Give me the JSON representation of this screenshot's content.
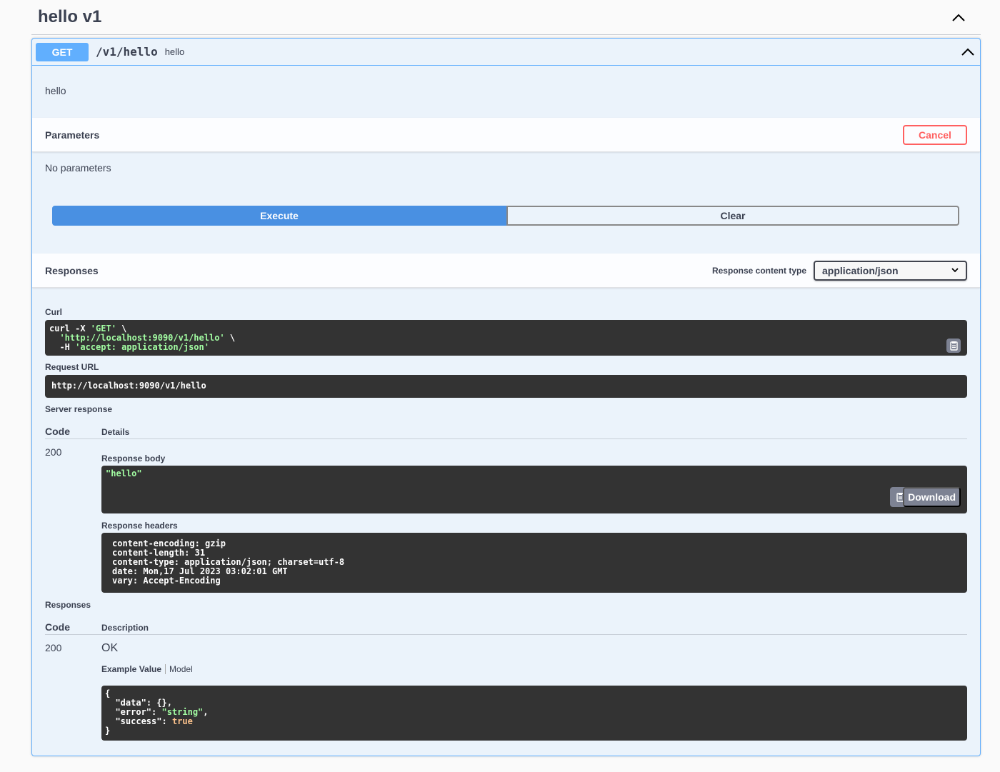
{
  "tag": {
    "title": "hello v1",
    "toggle_icon": "chevron-up-icon"
  },
  "operation": {
    "method": "GET",
    "path": "/v1/hello",
    "summary": "hello",
    "description": "hello",
    "collapse_icon": "chevron-up-icon"
  },
  "parameters": {
    "title": "Parameters",
    "cancel_label": "Cancel",
    "empty_text": "No parameters"
  },
  "actions": {
    "execute_label": "Execute",
    "clear_label": "Clear"
  },
  "responses_header": {
    "title": "Responses",
    "content_type_label": "Response content type",
    "content_type_value": "application/json"
  },
  "live": {
    "curl_label": "Curl",
    "curl_cmd_1": "curl -X ",
    "curl_method": "'GET'",
    "curl_cont_1": " \\",
    "curl_url": "'http://localhost:9090/v1/hello'",
    "curl_cont_2": " \\",
    "curl_h_flag": "  -H ",
    "curl_header": "'accept: application/json'",
    "request_url_label": "Request URL",
    "request_url": "http://localhost:9090/v1/hello",
    "server_response_label": "Server response",
    "code_header": "Code",
    "details_header": "Details",
    "status_code": "200",
    "response_body_label": "Response body",
    "response_body": "\"hello\"",
    "download_label": "Download",
    "response_headers_label": "Response headers",
    "response_headers": [
      "content-encoding: gzip",
      "content-length: 31",
      "content-type: application/json; charset=utf-8",
      "date: Mon,17 Jul 2023 03:02:01 GMT",
      "vary: Accept-Encoding"
    ]
  },
  "documented": {
    "title": "Responses",
    "code_header": "Code",
    "description_header": "Description",
    "code": "200",
    "description": "OK",
    "example_tab": "Example Value",
    "model_tab": "Model",
    "example_open": "{",
    "example_key_data": "\"data\"",
    "example_val_data": "{}",
    "example_key_error": "\"error\"",
    "example_val_error": "\"string\"",
    "example_key_success": "\"success\"",
    "example_val_success": "true",
    "example_close": "}"
  },
  "colors": {
    "get": "#61affe",
    "execute": "#4990e2",
    "cancel": "#ff6060",
    "code_bg": "#333333"
  }
}
